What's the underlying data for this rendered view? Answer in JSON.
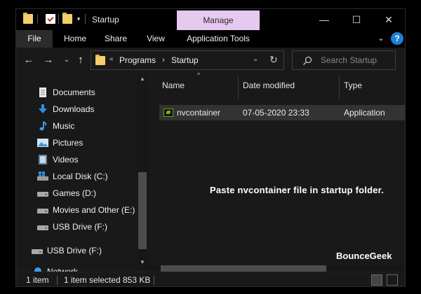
{
  "window": {
    "title": "Startup",
    "contextual_tab": "Manage",
    "controls": [
      "—",
      "☐",
      "✕"
    ]
  },
  "ribbon": {
    "tabs": [
      "File",
      "Home",
      "Share",
      "View",
      "Application Tools"
    ]
  },
  "address": {
    "overflow": "«",
    "crumbs": [
      "Programs",
      "Startup"
    ],
    "separator": "›"
  },
  "search": {
    "placeholder": "Search Startup"
  },
  "nav": {
    "items": [
      {
        "label": "Documents",
        "icon": "documents-icon"
      },
      {
        "label": "Downloads",
        "icon": "downloads-icon"
      },
      {
        "label": "Music",
        "icon": "music-icon"
      },
      {
        "label": "Pictures",
        "icon": "pictures-icon"
      },
      {
        "label": "Videos",
        "icon": "videos-icon"
      },
      {
        "label": "Local Disk (C:)",
        "icon": "windows-drive-icon"
      },
      {
        "label": "Games (D:)",
        "icon": "drive-icon"
      },
      {
        "label": "Movies and Other (E:)",
        "icon": "drive-icon"
      },
      {
        "label": "USB Drive (F:)",
        "icon": "usb-drive-icon"
      },
      {
        "label": "USB Drive (F:)",
        "icon": "usb-drive-icon"
      },
      {
        "label": "Network",
        "icon": "network-icon"
      }
    ]
  },
  "content": {
    "columns": [
      "Name",
      "Date modified",
      "Type"
    ],
    "rows": [
      {
        "name": "nvcontainer",
        "date": "07-05-2020 23:33",
        "type": "Application"
      }
    ],
    "caption": "Paste nvcontainer file in startup folder.",
    "brand": "BounceGeek"
  },
  "status": {
    "count": "1 item",
    "selected": "1 item selected",
    "size": "853 KB"
  },
  "colors": {
    "accent": "#1e7fd6",
    "manage_tab": "#e6c9ee",
    "folder": "#f4cf6b",
    "nvidia_green": "#76b900"
  }
}
